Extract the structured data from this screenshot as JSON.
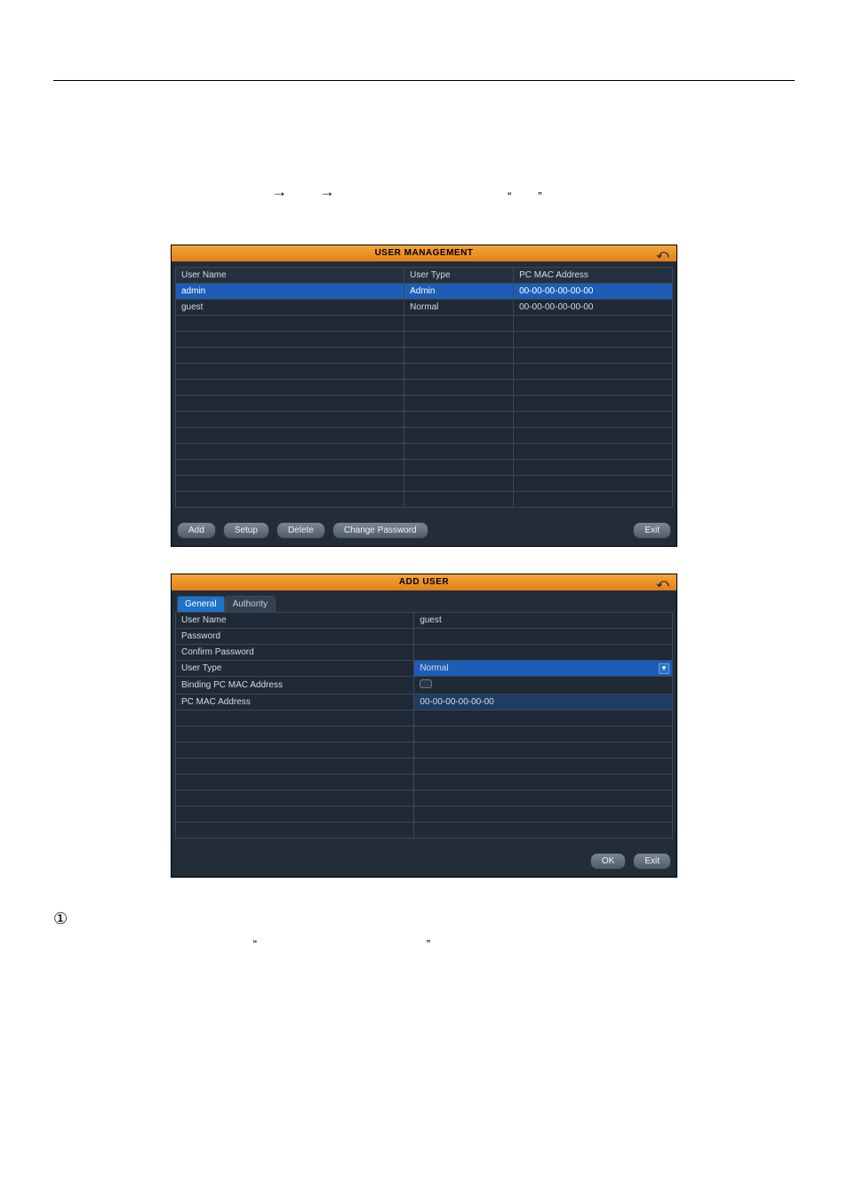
{
  "intro": {
    "arrow_glyph": "→",
    "open_quote": "“",
    "close_quote": "”"
  },
  "user_management": {
    "title": "USER MANAGEMENT",
    "columns": [
      "User Name",
      "User Type",
      "PC MAC Address"
    ],
    "rows": [
      {
        "name": "admin",
        "type": "Admin",
        "mac": "00-00-00-00-00-00",
        "selected": true
      },
      {
        "name": "guest",
        "type": "Normal",
        "mac": "00-00-00-00-00-00",
        "selected": false
      }
    ],
    "blank_rows": 12,
    "buttons": {
      "add": "Add",
      "setup": "Setup",
      "delete": "Delete",
      "change_password": "Change Password",
      "exit": "Exit"
    }
  },
  "add_user": {
    "title": "ADD USER",
    "tabs": {
      "general": "General",
      "authority": "Authority"
    },
    "fields": {
      "user_name_label": "User Name",
      "user_name_value": "guest",
      "password_label": "Password",
      "password_value": "",
      "confirm_password_label": "Confirm Password",
      "confirm_password_value": "",
      "user_type_label": "User Type",
      "user_type_value": "Normal",
      "binding_mac_label": "Binding PC MAC Address",
      "mac_label": "PC MAC Address",
      "mac_value": "00-00-00-00-00-00"
    },
    "blank_rows": 8,
    "buttons": {
      "ok": "OK",
      "exit": "Exit"
    }
  },
  "after": {
    "circled_one": "①",
    "open_quote": "“",
    "close_quote": "”"
  }
}
